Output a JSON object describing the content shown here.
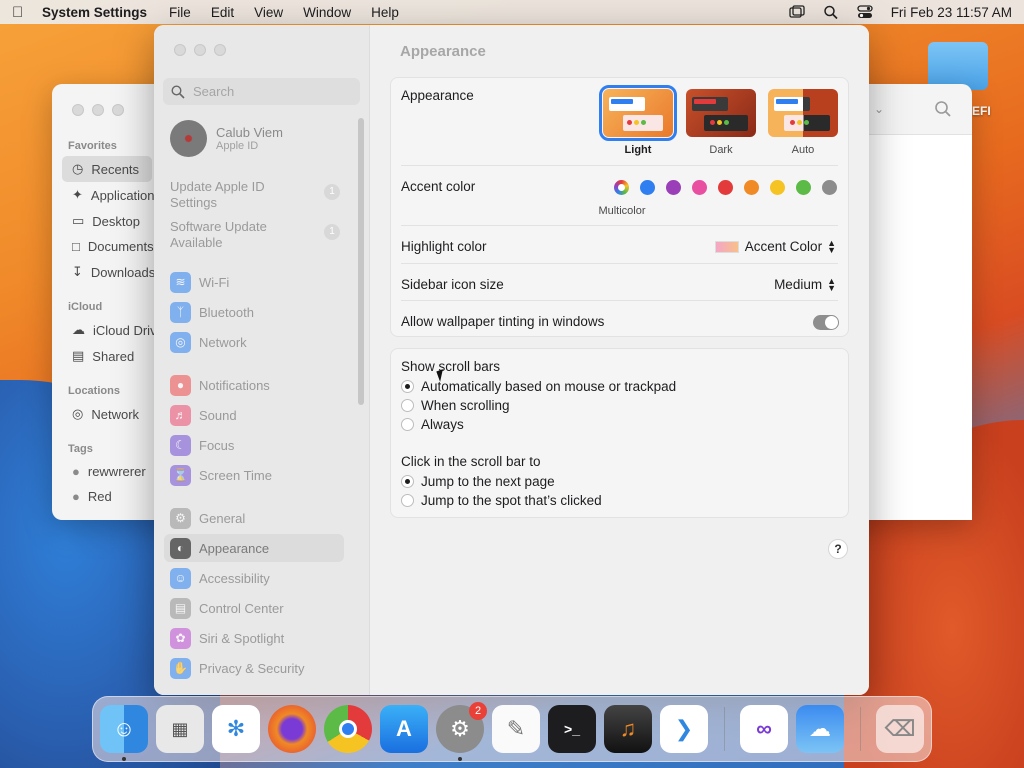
{
  "menubar": {
    "app_name": "System Settings",
    "items": [
      "File",
      "Edit",
      "View",
      "Window",
      "Help"
    ],
    "datetime": "Fri Feb 23  11:57 AM"
  },
  "desktop": {
    "folder_label": "EFI"
  },
  "finder": {
    "sections": [
      {
        "title": "Favorites",
        "items": [
          "Recents",
          "Applications",
          "Desktop",
          "Documents",
          "Downloads"
        ]
      },
      {
        "title": "iCloud",
        "items": [
          "iCloud Drive",
          "Shared"
        ]
      },
      {
        "title": "Locations",
        "items": [
          "Network"
        ]
      },
      {
        "title": "Tags",
        "items": [
          "rewwrerer",
          "Red"
        ]
      }
    ]
  },
  "settings": {
    "search_placeholder": "Search",
    "profile": {
      "name": "Calub Viem",
      "sub": "Apple ID"
    },
    "updates": [
      {
        "label": "Update Apple ID Settings",
        "count": "1"
      },
      {
        "label": "Software Update Available",
        "count": "1"
      }
    ],
    "nav": [
      {
        "label": "Wi-Fi",
        "color": "#3b8bf0"
      },
      {
        "label": "Bluetooth",
        "color": "#3b8bf0"
      },
      {
        "label": "Network",
        "color": "#3b8bf0"
      },
      {
        "label": "Notifications",
        "color": "#ef5a5a"
      },
      {
        "label": "Sound",
        "color": "#ef5a7a"
      },
      {
        "label": "Focus",
        "color": "#7a5ad6"
      },
      {
        "label": "Screen Time",
        "color": "#7a5ad6"
      },
      {
        "label": "General",
        "color": "#9a9a9a"
      },
      {
        "label": "Appearance",
        "color": "#333333"
      },
      {
        "label": "Accessibility",
        "color": "#3b8bf0"
      },
      {
        "label": "Control Center",
        "color": "#9a9a9a"
      },
      {
        "label": "Siri & Spotlight",
        "color": "#c25ad6"
      },
      {
        "label": "Privacy & Security",
        "color": "#3b8bf0"
      }
    ],
    "content": {
      "title": "Appearance",
      "appearance_label": "Appearance",
      "modes": [
        "Light",
        "Dark",
        "Auto"
      ],
      "accent_label": "Accent color",
      "accent_colors": [
        "#2f7ff0",
        "#9a3fb8",
        "#e84fa0",
        "#e33b3b",
        "#f08a24",
        "#f5c423",
        "#5cba47",
        "#8c8c8c"
      ],
      "accent_multicolor": "Multicolor",
      "highlight_label": "Highlight color",
      "highlight_value": "Accent Color",
      "sidebar_icon_label": "Sidebar icon size",
      "sidebar_icon_value": "Medium",
      "tinting_label": "Allow wallpaper tinting in windows",
      "scroll_label": "Show scroll bars",
      "scroll_options": [
        "Automatically based on mouse or trackpad",
        "When scrolling",
        "Always"
      ],
      "click_label": "Click in the scroll bar to",
      "click_options": [
        "Jump to the next page",
        "Jump to the spot that’s clicked"
      ],
      "help": "?"
    }
  },
  "dock": {
    "badge": "2"
  }
}
